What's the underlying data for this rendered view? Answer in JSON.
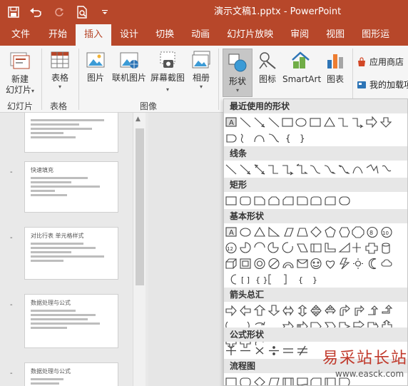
{
  "window": {
    "title": "演示文稿1.pptx - PowerPoint"
  },
  "tabs": [
    "文件",
    "开始",
    "插入",
    "设计",
    "切换",
    "动画",
    "幻灯片放映",
    "审阅",
    "视图",
    "图形运"
  ],
  "active_tab": "插入",
  "ribbon": {
    "new_slide": "新建",
    "new_slide_sub": "幻灯片",
    "slides_group": "幻灯片",
    "table": "表格",
    "tables_group": "表格",
    "picture": "图片",
    "online_picture": "联机图片",
    "screenshot": "屏幕截图",
    "album": "相册",
    "images_group": "图像",
    "shapes": "形状",
    "icons": "图标",
    "smartart": "SmartArt",
    "chart": "图表",
    "store": "应用商店",
    "my_addins": "我的加载项"
  },
  "shapes_panel": {
    "recent": "最近使用的形状",
    "lines": "线条",
    "rectangles": "矩形",
    "basic": "基本形状",
    "arrows": "箭头总汇",
    "equation": "公式形状",
    "flowchart": "流程图"
  },
  "slides": [
    {
      "num": "",
      "title": ""
    },
    {
      "num": "-",
      "title": "快速填充"
    },
    {
      "num": "-",
      "title": "对比行表  单元格样式"
    },
    {
      "num": "-",
      "title": "数据处理与公式"
    },
    {
      "num": "-",
      "title": "数据处理与公式"
    }
  ],
  "colors": {
    "accent": "#b7472a",
    "ribbon_bg": "#f5f5f5"
  },
  "watermark": {
    "text": "易采站长站",
    "url": "www.easck.com"
  }
}
